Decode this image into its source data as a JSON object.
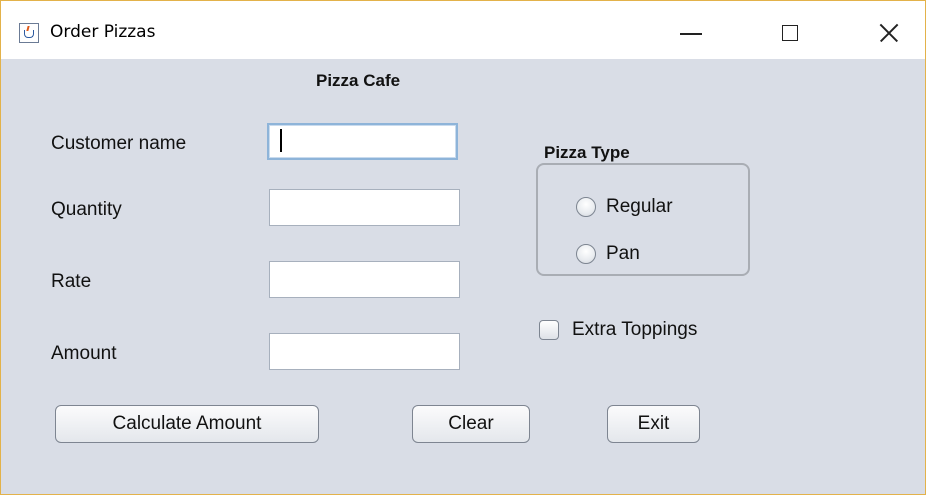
{
  "window": {
    "title": "Order Pizzas",
    "icon": "java-cup-icon",
    "controls": {
      "minimize": "minimize-icon",
      "maximize": "maximize-icon",
      "close": "close-icon"
    }
  },
  "form": {
    "heading": "Pizza Cafe",
    "fields": {
      "customer_name": {
        "label": "Customer name",
        "value": ""
      },
      "quantity": {
        "label": "Quantity",
        "value": ""
      },
      "rate": {
        "label": "Rate",
        "value": ""
      },
      "amount": {
        "label": "Amount",
        "value": ""
      }
    },
    "pizza_type": {
      "title": "Pizza Type",
      "options": [
        {
          "label": "Regular",
          "selected": false
        },
        {
          "label": "Pan",
          "selected": false
        }
      ]
    },
    "extra_toppings": {
      "label": "Extra Toppings",
      "checked": false
    },
    "buttons": {
      "calculate": "Calculate Amount",
      "clear": "Clear",
      "exit": "Exit"
    }
  },
  "colors": {
    "background": "#d9dde6",
    "titlebar": "#ffffff",
    "window_border": "#e3b24a",
    "focus_border": "#8eb4d9"
  }
}
